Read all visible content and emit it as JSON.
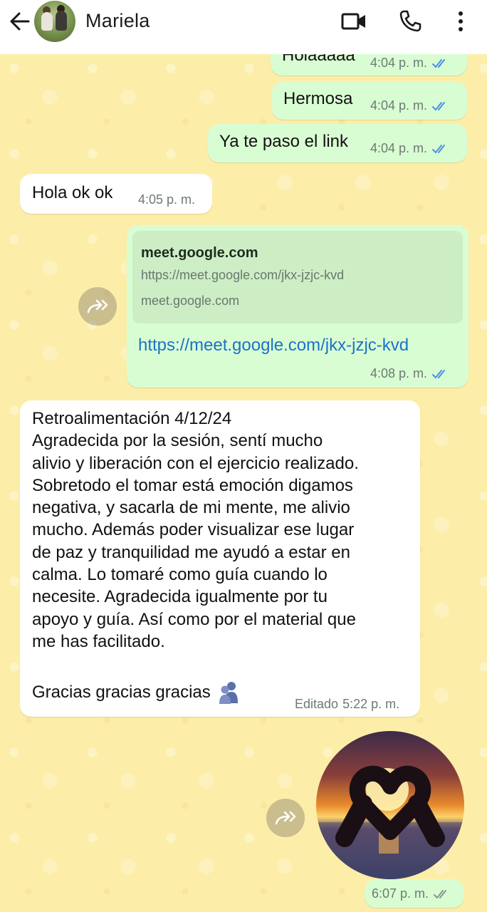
{
  "header": {
    "contact_name": "Mariela",
    "icons": [
      "back-arrow-icon",
      "video-call-icon",
      "phone-icon",
      "more-options-icon"
    ]
  },
  "colors": {
    "outgoing_bubble": "#d9fdd3",
    "incoming_bubble": "#ffffff",
    "wallpaper": "#fceea8",
    "read_tick": "#4a90e2",
    "link": "#1a73c7"
  },
  "messages": [
    {
      "direction": "out",
      "text": "Holaaaaa",
      "time": "4:04 p. m.",
      "status": "read"
    },
    {
      "direction": "out",
      "text": "Hermosa",
      "time": "4:04 p. m.",
      "status": "read"
    },
    {
      "direction": "out",
      "text": "Ya te paso el link",
      "time": "4:04 p. m.",
      "status": "read"
    },
    {
      "direction": "in",
      "text": "Hola ok ok",
      "time": "4:05 p. m."
    },
    {
      "direction": "out",
      "link_preview": {
        "title": "meet.google.com",
        "url": "https://meet.google.com/jkx-jzjc-kvd",
        "domain": "meet.google.com"
      },
      "text": "https://meet.google.com/jkx-jzjc-kvd",
      "time": "4:08 p. m.",
      "status": "read"
    },
    {
      "direction": "in",
      "lines": [
        "Retroalimentación 4/12/24",
        "Agradecida por la sesión, sentí mucho",
        "alivio y liberación con el ejercicio realizado.",
        "Sobretodo el tomar está emoción digamos",
        "negativa, y sacarla de mi mente, me alivio",
        "mucho. Además poder visualizar ese lugar",
        "de paz y tranquilidad me ayudó a estar en",
        "calma. Lo tomaré como guía cuando lo",
        "necesite. Agradecida igualmente por tu",
        "apoyo y guía. Así como por el material que",
        "me has facilitado."
      ],
      "closing": "Gracias gracias gracias",
      "edited_label": "Editado",
      "time": "5:22 p. m."
    },
    {
      "direction": "out",
      "type": "photo",
      "time": "6:07 p. m.",
      "status": "delivered"
    }
  ]
}
